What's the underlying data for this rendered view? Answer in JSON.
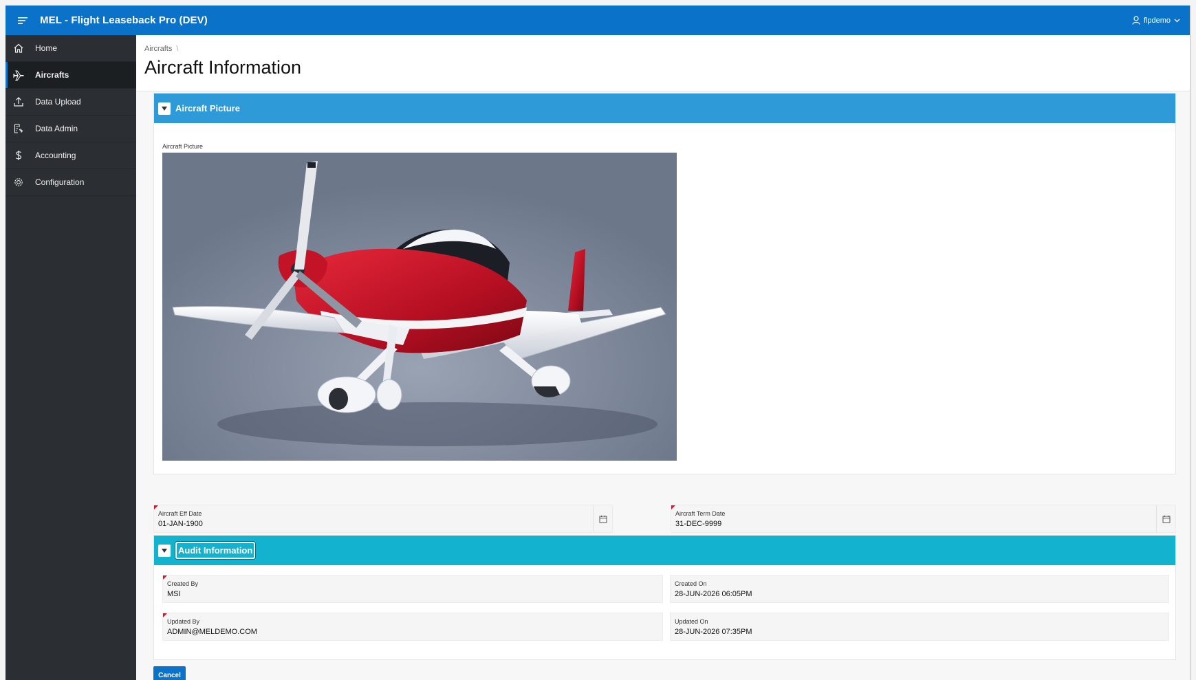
{
  "header": {
    "app_title": "MEL - Flight Leaseback Pro (DEV)",
    "user_name": "flpdemo"
  },
  "sidebar": {
    "items": [
      {
        "label": "Home",
        "icon": "home-icon",
        "active": false
      },
      {
        "label": "Aircrafts",
        "icon": "plane-icon",
        "active": true
      },
      {
        "label": "Data Upload",
        "icon": "upload-icon",
        "active": false
      },
      {
        "label": "Data Admin",
        "icon": "data-admin-icon",
        "active": false
      },
      {
        "label": "Accounting",
        "icon": "dollar-icon",
        "active": false
      },
      {
        "label": "Configuration",
        "icon": "gear-icon",
        "active": false
      }
    ]
  },
  "breadcrumb": {
    "items": [
      "Aircrafts"
    ],
    "separator": "\\"
  },
  "page": {
    "title": "Aircraft Information"
  },
  "picture_region": {
    "title": "Aircraft Picture",
    "field_label": "Aircraft Picture",
    "header_color": "#2f9ad8"
  },
  "dates": {
    "eff_label": "Aircraft Eff Date",
    "eff_value": "01-JAN-1900",
    "term_label": "Aircraft Term Date",
    "term_value": "31-DEC-9999"
  },
  "audit_region": {
    "title": "Audit Information",
    "header_color": "#13b3d0",
    "created_by_label": "Created By",
    "created_by_value": "MSI",
    "created_on_label": "Created On",
    "created_on_value": "28-JUN-2026 06:05PM",
    "updated_by_label": "Updated By",
    "updated_by_value": "ADMIN@MELDEMO.COM",
    "updated_on_label": "Updated On",
    "updated_on_value": "28-JUN-2026 07:35PM"
  },
  "actions": {
    "cancel_label": "Cancel"
  },
  "colors": {
    "brand": "#0b72c9",
    "sidebar": "#2b2f33",
    "required": "#d5162b"
  }
}
